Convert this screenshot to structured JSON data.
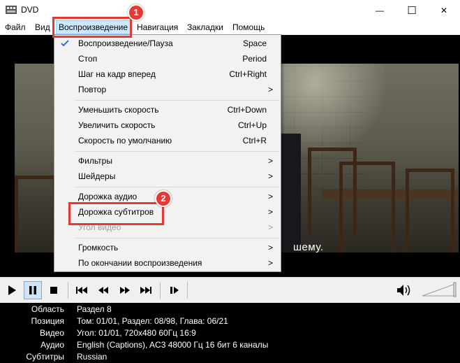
{
  "window": {
    "title": "DVD",
    "minimize": "—",
    "maximize": "☐",
    "close": "✕"
  },
  "menubar": [
    "Файл",
    "Вид",
    "Воспроизведение",
    "Навигация",
    "Закладки",
    "Помощь"
  ],
  "dropdown": {
    "items": [
      {
        "label": "Воспроизведение/Пауза",
        "shortcut": "Space",
        "checked": true
      },
      {
        "label": "Стоп",
        "shortcut": "Period"
      },
      {
        "label": "Шаг на кадр вперед",
        "shortcut": "Ctrl+Right"
      },
      {
        "label": "Повтор",
        "submenu": ">"
      },
      {
        "label": "Уменьшить скорость",
        "shortcut": "Ctrl+Down"
      },
      {
        "label": "Увеличить скорость",
        "shortcut": "Ctrl+Up"
      },
      {
        "label": "Скорость по умолчанию",
        "shortcut": "Ctrl+R"
      },
      {
        "label": "Фильтры",
        "submenu": ">"
      },
      {
        "label": "Шейдеры",
        "submenu": ">"
      },
      {
        "label": "Дорожка аудио",
        "submenu": ">"
      },
      {
        "label": "Дорожка субтитров",
        "submenu": ">"
      },
      {
        "label": "Угол видео",
        "submenu": ">",
        "disabled": true
      },
      {
        "label": "Громкость",
        "submenu": ">"
      },
      {
        "label": "По окончании воспроизведения",
        "submenu": ">"
      }
    ]
  },
  "video": {
    "subtitle": "шему."
  },
  "annotations": {
    "badge1": "1",
    "badge2": "2"
  },
  "info": {
    "rows": [
      {
        "label": "Область",
        "value": "Раздел 8"
      },
      {
        "label": "Позиция",
        "value": "Том: 01/01, Раздел: 08/98, Глава: 06/21"
      },
      {
        "label": "Видео",
        "value": "Угол: 01/01, 720x480 60Гц 16:9"
      },
      {
        "label": "Аудио",
        "value": "English (Captions), AC3 48000 Гц 16 бит 6 каналы"
      },
      {
        "label": "Субтитры",
        "value": "Russian"
      }
    ]
  },
  "colors": {
    "annotation": "#e53935",
    "menu_highlight": "#cce8ff"
  }
}
